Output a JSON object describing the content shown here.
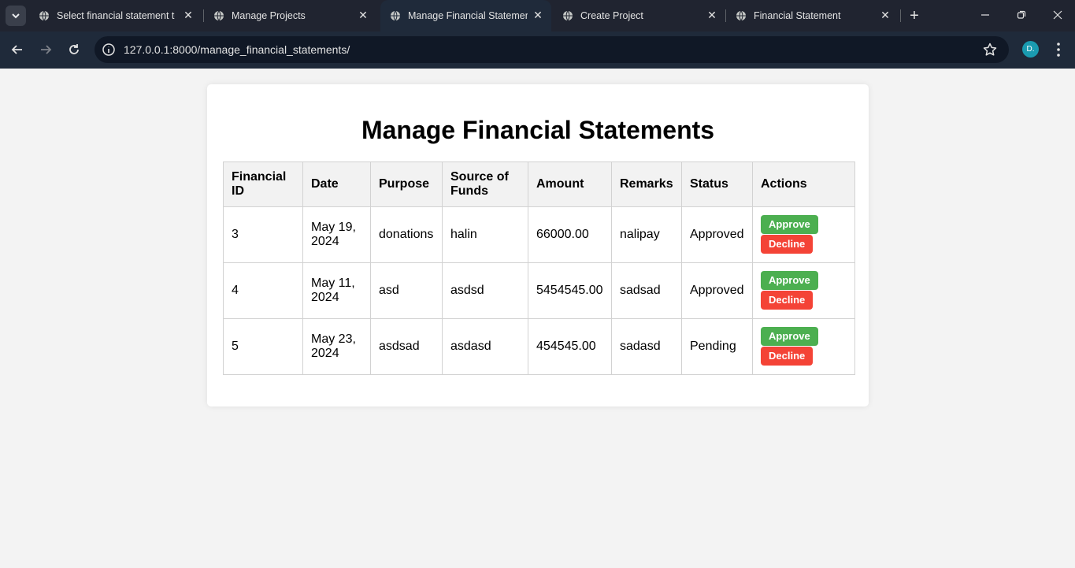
{
  "browser": {
    "tabs": [
      {
        "title": "Select financial statement to",
        "active": false
      },
      {
        "title": "Manage Projects",
        "active": false
      },
      {
        "title": "Manage Financial Statements",
        "active": true
      },
      {
        "title": "Create Project",
        "active": false
      },
      {
        "title": "Financial Statement",
        "active": false
      }
    ],
    "url": "127.0.0.1:8000/manage_financial_statements/",
    "profile_initial": "D."
  },
  "page": {
    "title": "Manage Financial Statements",
    "columns": [
      "Financial ID",
      "Date",
      "Purpose",
      "Source of Funds",
      "Amount",
      "Remarks",
      "Status",
      "Actions"
    ],
    "rows": [
      {
        "id": "3",
        "date": "May 19, 2024",
        "purpose": "donations",
        "source": "halin",
        "amount": "66000.00",
        "remarks": "nalipay",
        "status": "Approved"
      },
      {
        "id": "4",
        "date": "May 11, 2024",
        "purpose": "asd",
        "source": "asdsd",
        "amount": "5454545.00",
        "remarks": "sadsad",
        "status": "Approved"
      },
      {
        "id": "5",
        "date": "May 23, 2024",
        "purpose": "asdsad",
        "source": "asdasd",
        "amount": "454545.00",
        "remarks": "sadasd",
        "status": "Pending"
      }
    ],
    "approve_label": "Approve",
    "decline_label": "Decline"
  }
}
